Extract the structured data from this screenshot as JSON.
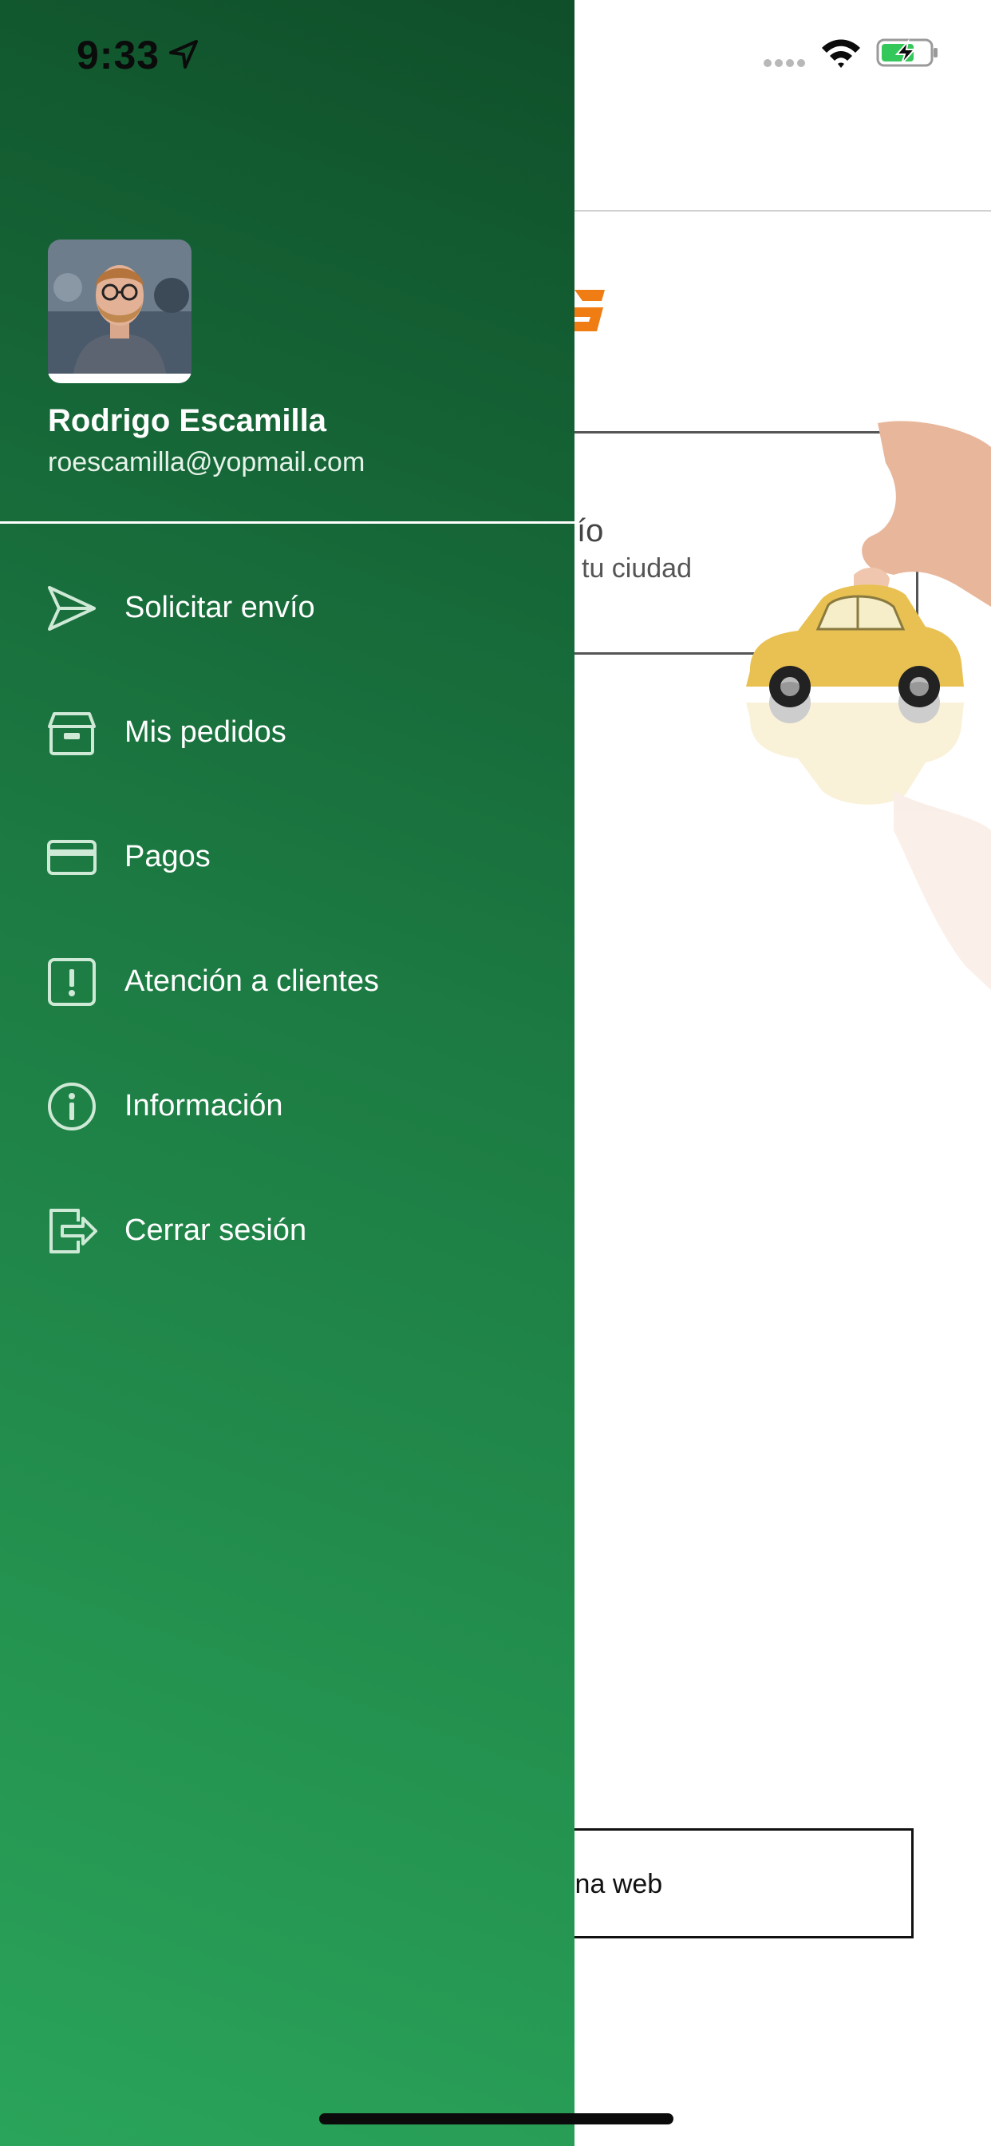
{
  "status_bar": {
    "time": "9:33"
  },
  "background_screen": {
    "title_fragment": "ío",
    "card": {
      "title_fragment": "ío",
      "subtitle_fragment": "tu ciudad"
    },
    "web_button_fragment": "ina web",
    "colors": {
      "logo_accent": "#f07c14",
      "car": "#e8c152"
    }
  },
  "drawer": {
    "user": {
      "name": "Rodrigo Escamilla",
      "email": "roescamilla@yopmail.com"
    },
    "menu": [
      {
        "label": "Solicitar envío",
        "icon": "send-icon"
      },
      {
        "label": "Mis pedidos",
        "icon": "box-icon"
      },
      {
        "label": "Pagos",
        "icon": "card-icon"
      },
      {
        "label": "Atención a clientes",
        "icon": "alert-icon"
      },
      {
        "label": "Información",
        "icon": "info-icon"
      },
      {
        "label": "Cerrar sesión",
        "icon": "logout-icon"
      }
    ],
    "colors": {
      "gradient_top": "#0f4f2a",
      "gradient_bottom": "#2aa45a",
      "icon": "#cfe9d7"
    }
  }
}
